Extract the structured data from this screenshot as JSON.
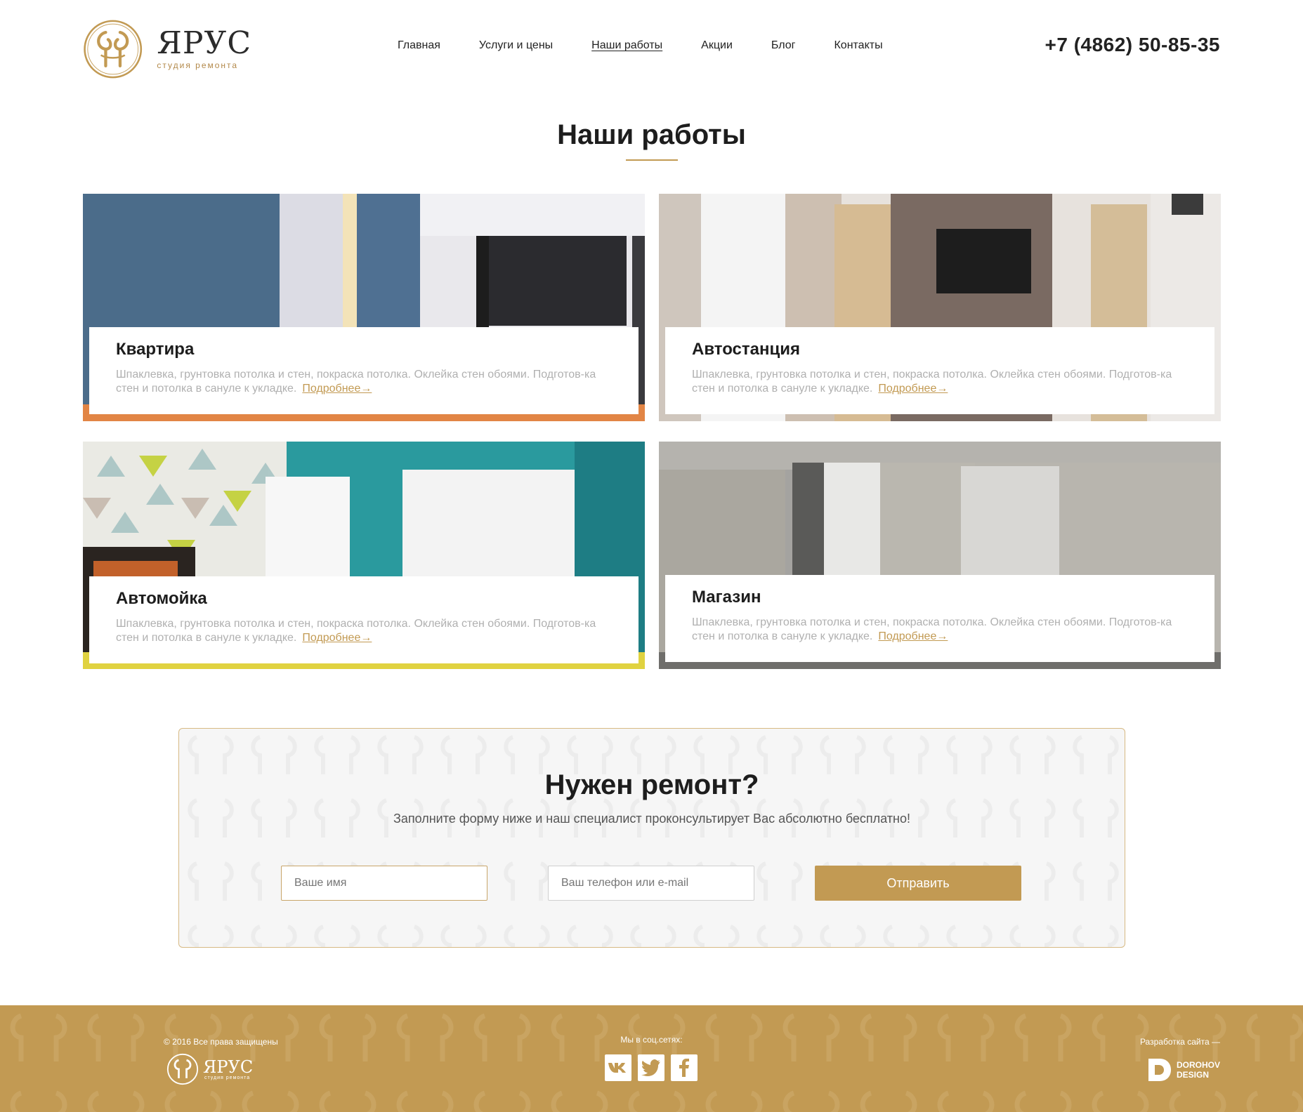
{
  "brand": {
    "name": "ЯРУС",
    "tagline": "студия ремонта",
    "accent_color": "#c29a53"
  },
  "nav": {
    "items": [
      {
        "label": "Главная"
      },
      {
        "label": "Услуги и цены"
      },
      {
        "label": "Наши работы"
      },
      {
        "label": "Акции"
      },
      {
        "label": "Блог"
      },
      {
        "label": "Контакты"
      }
    ],
    "active": "Наши работы"
  },
  "phone": "+7 (4862) 50-85-35",
  "page_title": "Наши работы",
  "works": [
    {
      "title": "Квартира",
      "text": "Шпаклевка, грунтовка потолка и стен, покраска потолка. Оклейка стен обоями. Подготов-ка стен и потолка в сануле к укладке.",
      "more": "Подробнее→"
    },
    {
      "title": "Автостанция",
      "text": "Шпаклевка, грунтовка потолка и стен, покраска потолка. Оклейка стен обоями. Подготов-ка стен и потолка в сануле к укладке.",
      "more": "Подробнее→"
    },
    {
      "title": "Автомойка",
      "text": "Шпаклевка, грунтовка потолка и стен, покраска потолка. Оклейка стен обоями. Подготов-ка стен и потолка в сануле к укладке.",
      "more": "Подробнее→"
    },
    {
      "title": "Магазин",
      "text": "Шпаклевка, грунтовка потолка и стен, покраска потолка. Оклейка стен обоями. Подготов-ка стен и потолка в сануле к укладке.",
      "more": "Подробнее→"
    }
  ],
  "form": {
    "title": "Нужен ремонт?",
    "subtitle": "Заполните форму ниже и наш специалист проконсультирует Вас абсолютно бесплатно!",
    "name_placeholder": "Ваше имя",
    "contact_placeholder": "Ваш телефон или e-mail",
    "submit_label": "Отправить"
  },
  "footer": {
    "copyright": "© 2016 Все права защищены",
    "social_label": "Мы в соц.сетях:",
    "social_icons": [
      "vk-icon",
      "twitter-icon",
      "facebook-icon"
    ],
    "developer_label": "Разработка сайта —",
    "developer_name_line1": "DOROHOV",
    "developer_name_line2": "DESIGN"
  }
}
